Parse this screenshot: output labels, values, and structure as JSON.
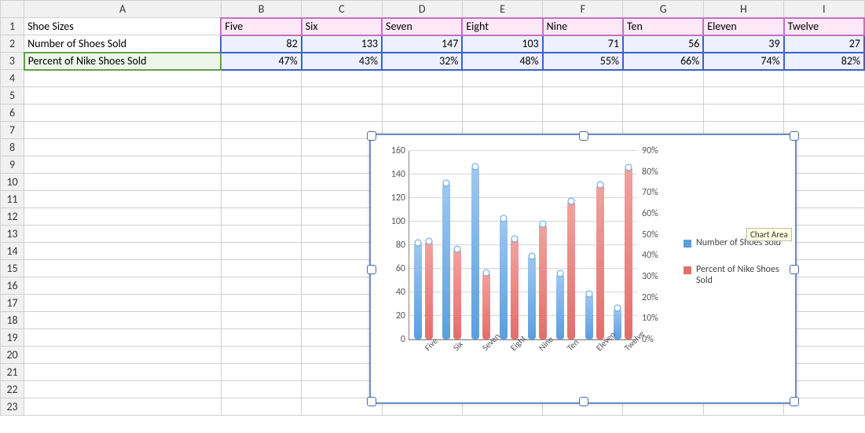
{
  "columns": [
    "A",
    "B",
    "C",
    "D",
    "E",
    "F",
    "G",
    "H",
    "I"
  ],
  "rowLabels": {
    "r1": "Shoe Sizes",
    "r2": "Number of Shoes Sold",
    "r3": "Percent of Nike Shoes Sold"
  },
  "sizes": [
    "Five",
    "Six",
    "Seven",
    "Eight",
    "Nine",
    "Ten",
    "Eleven",
    "Twelve"
  ],
  "sold": [
    "82",
    "133",
    "147",
    "103",
    "71",
    "56",
    "39",
    "27"
  ],
  "pct": [
    "47%",
    "43%",
    "32%",
    "48%",
    "55%",
    "66%",
    "74%",
    "82%"
  ],
  "legend": {
    "s1": "Number of Shoes Sold",
    "s2": "Percent of Nike Shoes Sold"
  },
  "tooltip": "Chart Area",
  "yLeftTicks": [
    "0",
    "20",
    "40",
    "60",
    "80",
    "100",
    "120",
    "140",
    "160"
  ],
  "yRightTicks": [
    "0%",
    "10%",
    "20%",
    "30%",
    "40%",
    "50%",
    "60%",
    "70%",
    "80%",
    "90%"
  ],
  "chart_data": {
    "type": "bar",
    "categories": [
      "Five",
      "Six",
      "Seven",
      "Eight",
      "Nine",
      "Ten",
      "Eleven",
      "Twelve"
    ],
    "series": [
      {
        "name": "Number of Shoes Sold",
        "axis": "left",
        "values": [
          82,
          133,
          147,
          103,
          71,
          56,
          39,
          27
        ]
      },
      {
        "name": "Percent of Nike Shoes Sold",
        "axis": "right",
        "values": [
          0.47,
          0.43,
          0.32,
          0.48,
          0.55,
          0.66,
          0.74,
          0.82
        ]
      }
    ],
    "yLeft": {
      "min": 0,
      "max": 160,
      "step": 20,
      "label": ""
    },
    "yRight": {
      "min": 0,
      "max": 0.9,
      "step": 0.1,
      "label": "",
      "format": "percent"
    },
    "title": "",
    "xlabel": "",
    "legend_position": "right"
  }
}
